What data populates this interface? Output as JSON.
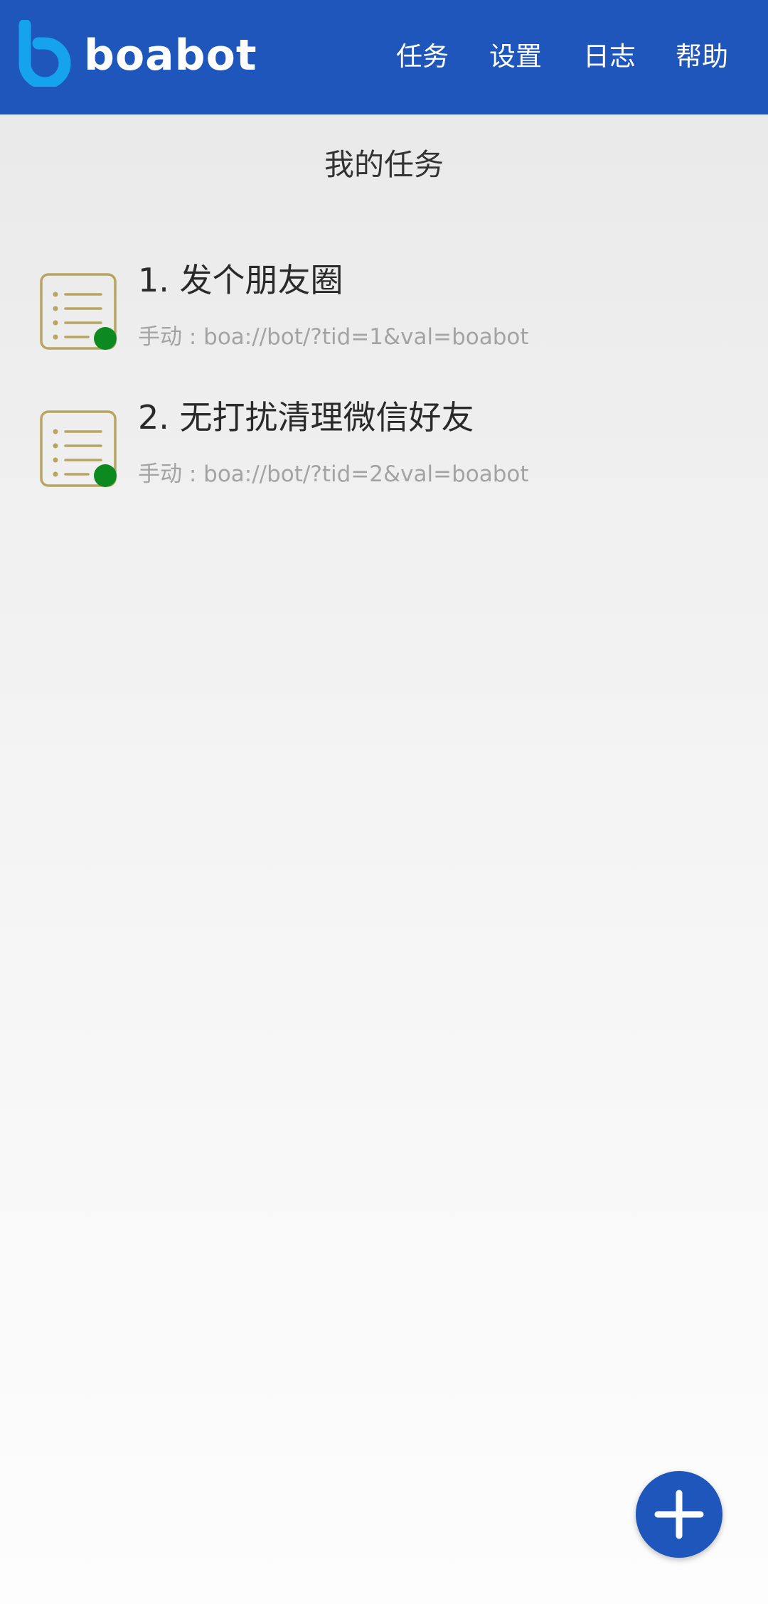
{
  "header": {
    "brand": "boabot",
    "nav": [
      "任务",
      "设置",
      "日志",
      "帮助"
    ]
  },
  "page_title": "我的任务",
  "tasks": [
    {
      "title": "1. 发个朋友圈",
      "subtitle": "手动 : boa://bot/?tid=1&val=boabot"
    },
    {
      "title": "2. 无打扰清理微信好友",
      "subtitle": "手动 : boa://bot/?tid=2&val=boabot"
    }
  ],
  "icons": {
    "logo": "boabot-logo-icon",
    "task": "task-list-icon",
    "status": "status-dot-icon",
    "fab": "add-icon"
  },
  "colors": {
    "header_bg": "#1f56bb",
    "logo": "#16a3ee",
    "task_icon": "#b8a560",
    "status_dot": "#0d8a1f",
    "fab_bg": "#1f56bb"
  }
}
